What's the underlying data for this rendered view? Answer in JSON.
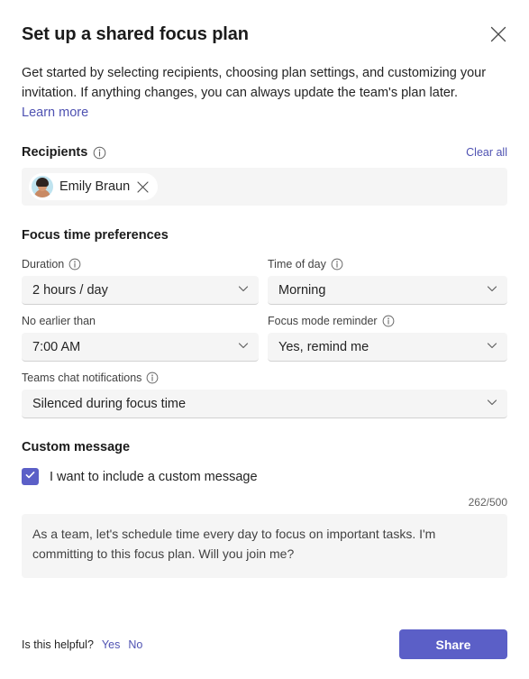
{
  "dialog": {
    "title": "Set up a shared focus plan",
    "close_icon": "close-icon",
    "intro_text": "Get started by selecting recipients, choosing plan settings, and customizing your invitation. If anything changes, you can always update the team's plan later. ",
    "intro_link": "Learn more"
  },
  "recipients": {
    "label": "Recipients",
    "info_icon": "info-icon",
    "clear_all": "Clear all",
    "chips": [
      {
        "name": "Emily Braun",
        "remove_icon": "close-icon"
      }
    ]
  },
  "focus_preferences": {
    "heading": "Focus time preferences",
    "fields": [
      {
        "label": "Duration",
        "value": "2 hours / day",
        "has_info": true
      },
      {
        "label": "Time of day",
        "value": "Morning",
        "has_info": true
      },
      {
        "label": "No earlier than",
        "value": "7:00 AM",
        "has_info": false
      },
      {
        "label": "Focus mode reminder",
        "value": "Yes, remind me",
        "has_info": true
      },
      {
        "label": "Teams chat notifications",
        "value": "Silenced during focus time",
        "has_info": true
      }
    ]
  },
  "custom_message": {
    "heading": "Custom message",
    "checkbox_label": "I want to include a custom message",
    "checkbox_checked": true,
    "counter": "262/500",
    "message": "As a team, let's schedule time every day to focus on important tasks. I'm committing to this focus plan. Will you join me?"
  },
  "footer": {
    "helpful_text": "Is this helpful?",
    "yes_label": "Yes",
    "no_label": "No",
    "share_label": "Share"
  },
  "colors": {
    "accent": "#5b5fc7",
    "link": "#4f52b2",
    "field_bg": "#f5f5f5"
  }
}
